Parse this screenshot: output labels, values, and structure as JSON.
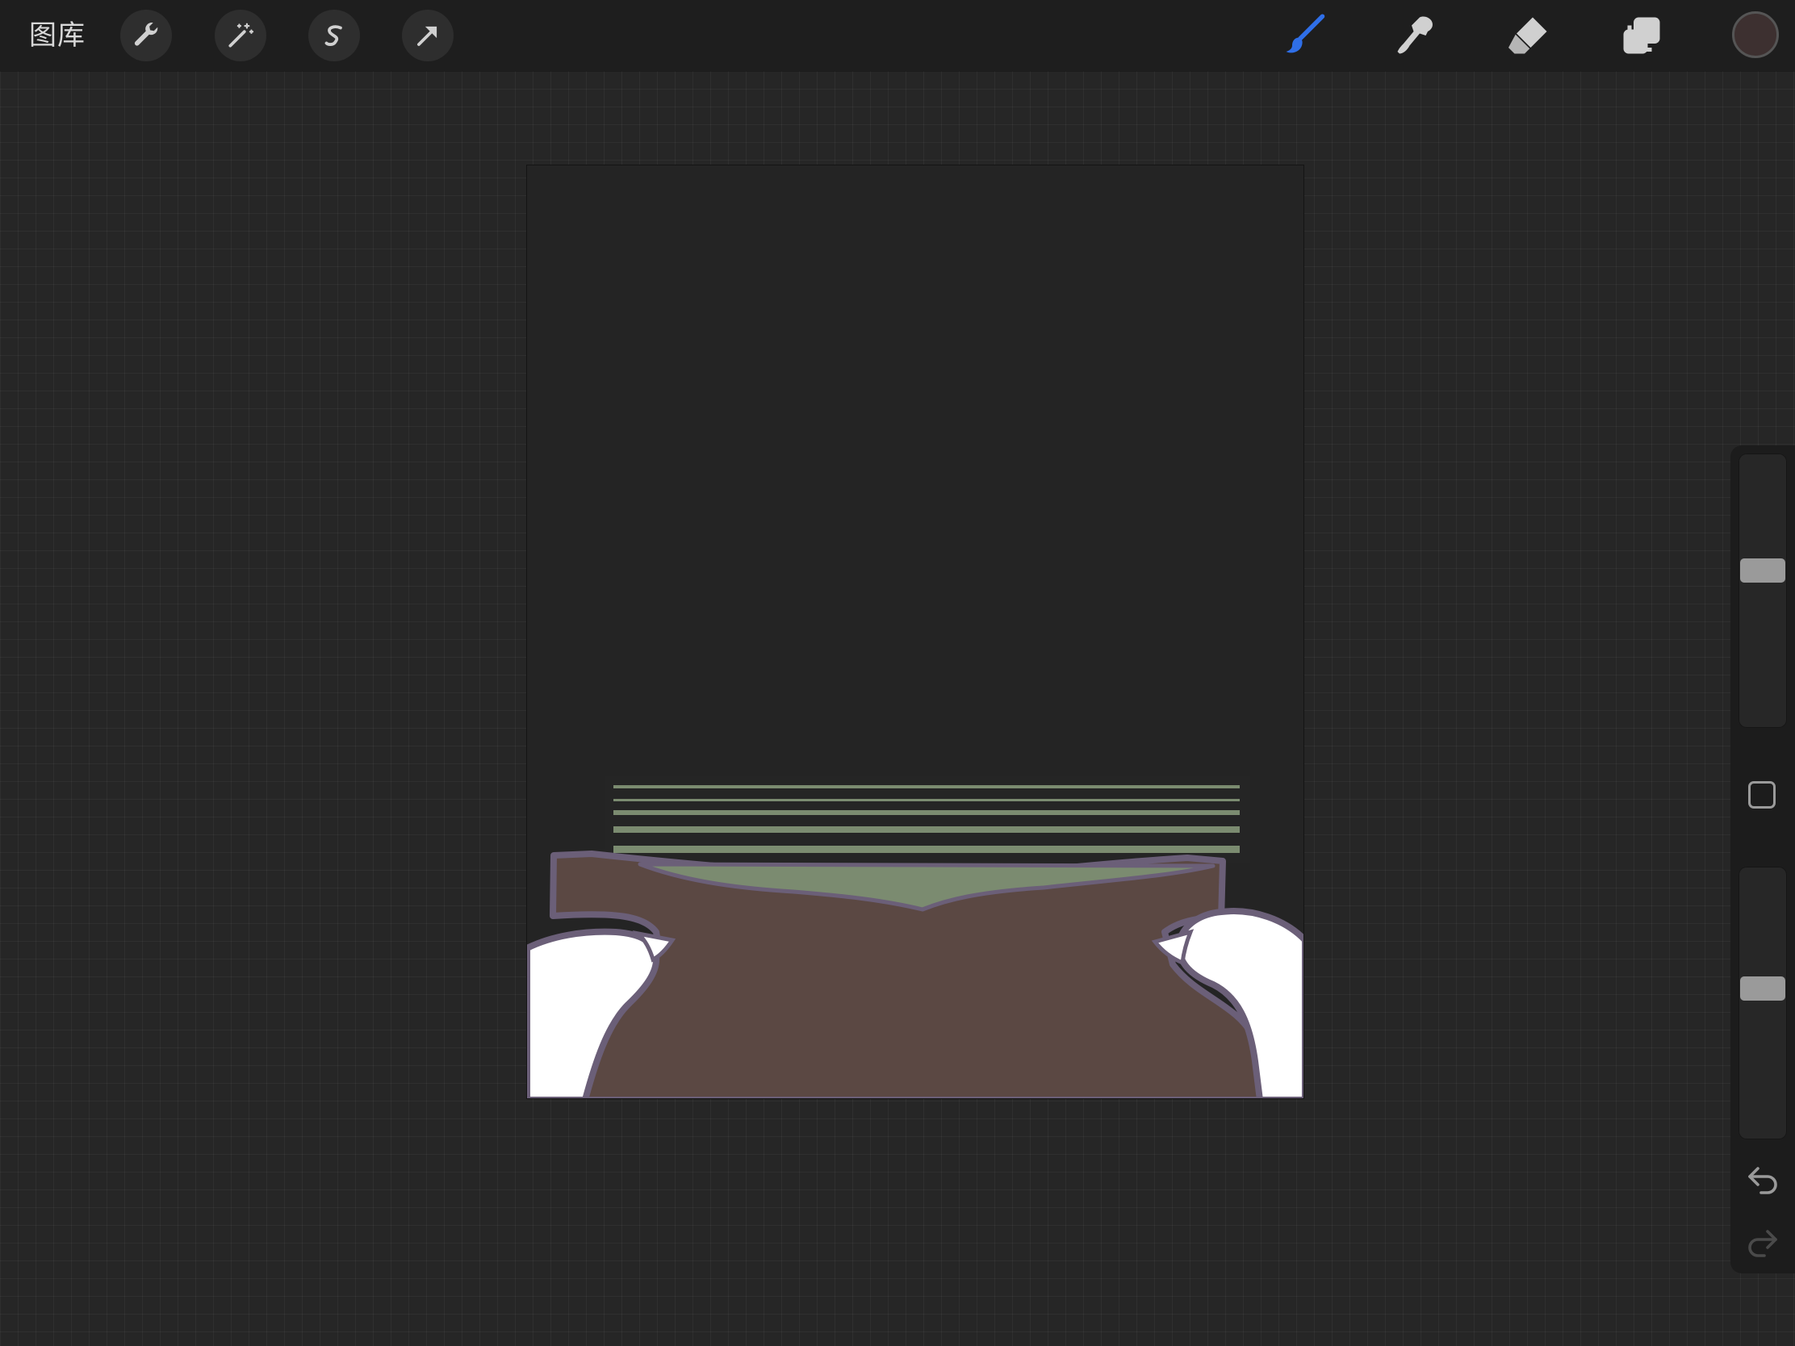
{
  "toolbar": {
    "gallery_label": "图库",
    "left_tools": [
      "wrench-icon",
      "magic-wand-icon",
      "selection-icon",
      "transform-arrow-icon"
    ],
    "right_tools": [
      "brush-icon",
      "smudge-icon",
      "eraser-icon",
      "layers-icon"
    ],
    "active_tool": "brush-icon",
    "active_color": "#2f6fe8",
    "current_color": "#3d3030"
  },
  "sidebar": {
    "brush_size_level": 0.58,
    "opacity_level": 0.56
  },
  "canvas": {
    "colors": {
      "background": "#242424",
      "body": "#5b4843",
      "outline": "#6b5f78",
      "green": "#7b8b70",
      "stripes_dark": "#282828",
      "paws": "#ffffff"
    }
  }
}
